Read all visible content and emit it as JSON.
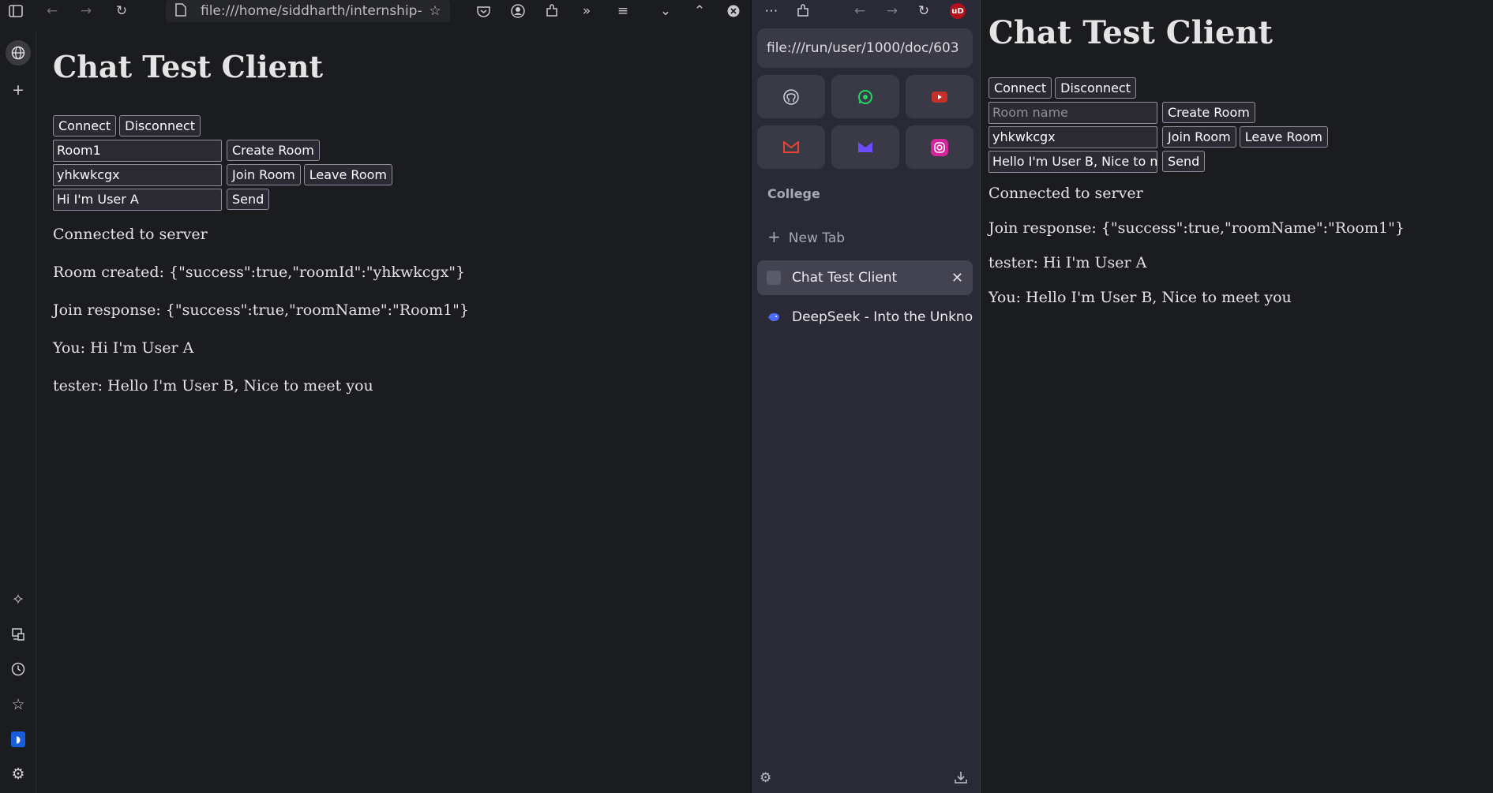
{
  "left_window": {
    "url": "file:///home/siddharth/internship-",
    "page": {
      "title": "Chat Test Client",
      "connect_label": "Connect",
      "disconnect_label": "Disconnect",
      "room_name_value": "Room1",
      "create_room_label": "Create Room",
      "room_id_value": "yhkwkcgx",
      "join_room_label": "Join Room",
      "leave_room_label": "Leave Room",
      "message_value": "Hi I'm User A",
      "send_label": "Send",
      "messages": [
        "Connected to server",
        "Room created: {\"success\":true,\"roomId\":\"yhkwkcgx\"}",
        "Join response: {\"success\":true,\"roomName\":\"Room1\"}",
        "You: Hi I'm User A",
        "tester: Hello I'm User B, Nice to meet you"
      ]
    }
  },
  "right_window": {
    "url": "file:///run/user/1000/doc/603",
    "ublock_badge": "uD",
    "section_label": "College",
    "new_tab_label": "New Tab",
    "tabs": [
      {
        "label": "Chat Test Client",
        "active": true
      },
      {
        "label": "DeepSeek - Into the Unknown",
        "active": false
      }
    ],
    "page": {
      "title": "Chat Test Client",
      "connect_label": "Connect",
      "disconnect_label": "Disconnect",
      "room_name_placeholder": "Room name",
      "create_room_label": "Create Room",
      "room_id_value": "yhkwkcgx",
      "join_room_label": "Join Room",
      "leave_room_label": "Leave Room",
      "message_value": "Hello I'm User B, Nice to m",
      "send_label": "Send",
      "messages": [
        "Connected to server",
        "Join response: {\"success\":true,\"roomName\":\"Room1\"}",
        "tester: Hi I'm User A",
        "You: Hello I'm User B, Nice to meet you"
      ]
    }
  },
  "shortcut_tiles": [
    {
      "icon": "github-icon",
      "color": "#cfcfd6"
    },
    {
      "icon": "whatsapp-icon",
      "color": "#25d366"
    },
    {
      "icon": "youtube-icon",
      "color": "#c4302b"
    },
    {
      "icon": "gmail-icon",
      "color": "#ea4335"
    },
    {
      "icon": "proton-mail-icon",
      "color": "#6d4aff"
    },
    {
      "icon": "instagram-icon",
      "color": "#d6249f"
    }
  ]
}
